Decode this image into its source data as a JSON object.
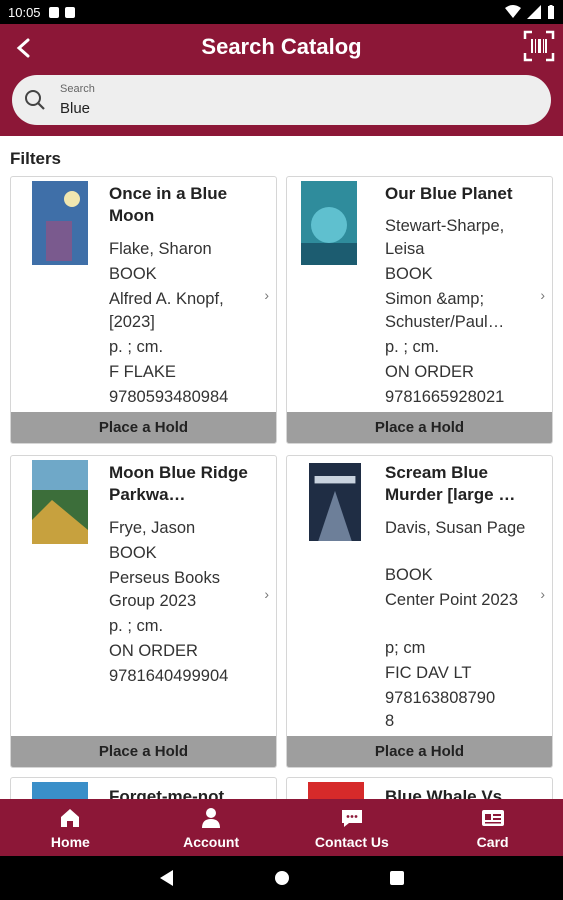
{
  "status_bar": {
    "time": "10:05"
  },
  "header": {
    "title": "Search Catalog"
  },
  "search": {
    "label": "Search",
    "value": "Blue"
  },
  "filters_label": "Filters",
  "hold_label": "Place a Hold",
  "results": [
    {
      "title": "Once in a Blue Moon",
      "author": "Flake, Sharon",
      "format": "BOOK",
      "publisher": "Alfred A. Knopf, [2023]",
      "description": "p. ; cm.",
      "call_number": "F FLAKE",
      "isbn": "9780593480984",
      "cover_color": "#3f6fa8"
    },
    {
      "title": "Our Blue Planet",
      "author": "Stewart-Sharpe, Leisa",
      "format": "BOOK",
      "publisher": "Simon &amp; Schuster/Paul…",
      "description": "p. ; cm.",
      "call_number": "ON ORDER",
      "isbn": "9781665928021",
      "cover_color": "#2f8c9c"
    },
    {
      "title": "Moon Blue Ridge Parkwa…",
      "author": "Frye, Jason",
      "format": "BOOK",
      "publisher": "Perseus Books Group 2023",
      "description": "p. ; cm.",
      "call_number": "ON ORDER",
      "isbn": "9781640499904",
      "cover_color": "#3c6e3a"
    },
    {
      "title": "Scream Blue Murder [large …",
      "author": "Davis, Susan Page",
      "format": "BOOK",
      "publisher": "Center Point 2023",
      "description": "p; cm",
      "call_number": "FIC DAV LT",
      "isbn": "978163808790\n8",
      "cover_color": "#1f2d44"
    },
    {
      "title": "Forget-me-not",
      "cover_color": "#3a8fc9"
    },
    {
      "title": "Blue Whale Vs",
      "cover_color": "#d62a2a"
    }
  ],
  "bottom_nav": [
    {
      "label": "Home",
      "icon": "home-icon"
    },
    {
      "label": "Account",
      "icon": "person-icon"
    },
    {
      "label": "Contact Us",
      "icon": "chat-icon"
    },
    {
      "label": "Card",
      "icon": "id-card-icon"
    }
  ],
  "colors": {
    "brand": "#8c1737",
    "hold_button": "#9e9e9e"
  }
}
